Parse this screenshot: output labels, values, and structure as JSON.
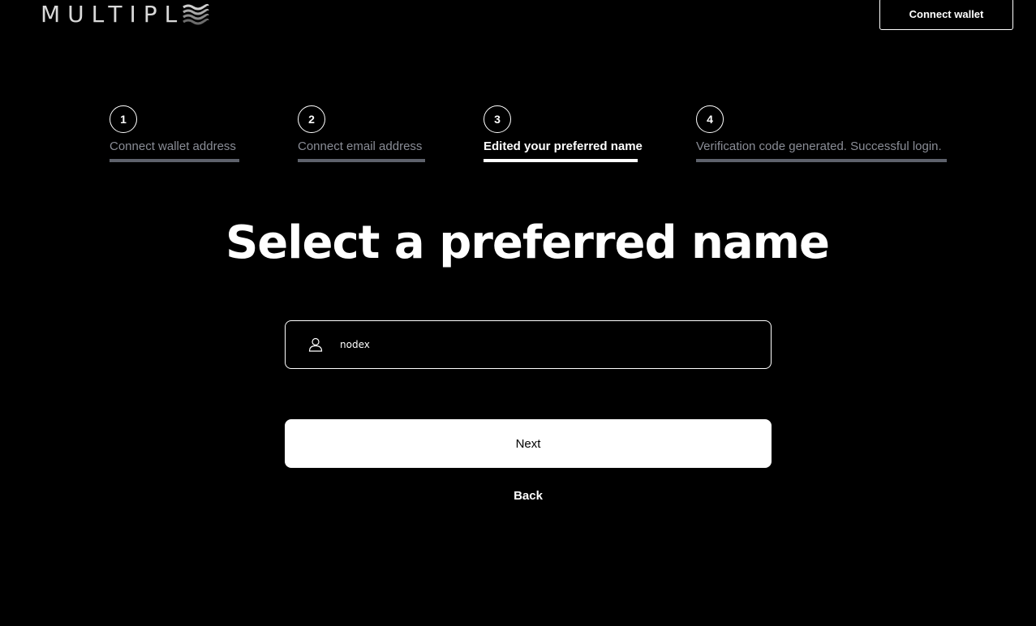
{
  "header": {
    "logo_text": "MULTIPL",
    "logo_mark_icon": "waves-logo-mark",
    "connect_wallet_label": "Connect wallet"
  },
  "stepper": {
    "active_step": 3,
    "steps": [
      {
        "number": "1",
        "label": "Connect wallet address"
      },
      {
        "number": "2",
        "label": "Connect email address"
      },
      {
        "number": "3",
        "label": "Edited your preferred name"
      },
      {
        "number": "4",
        "label": "Verification code generated. Successful login."
      }
    ]
  },
  "main": {
    "title": "Select a preferred name",
    "name_input": {
      "icon": "user-icon",
      "value": "nodex"
    },
    "next_label": "Next",
    "back_label": "Back"
  },
  "colors": {
    "background": "#000000",
    "foreground": "#ffffff",
    "inactive_text": "#8a8d96",
    "inactive_bar": "#5e626c"
  }
}
